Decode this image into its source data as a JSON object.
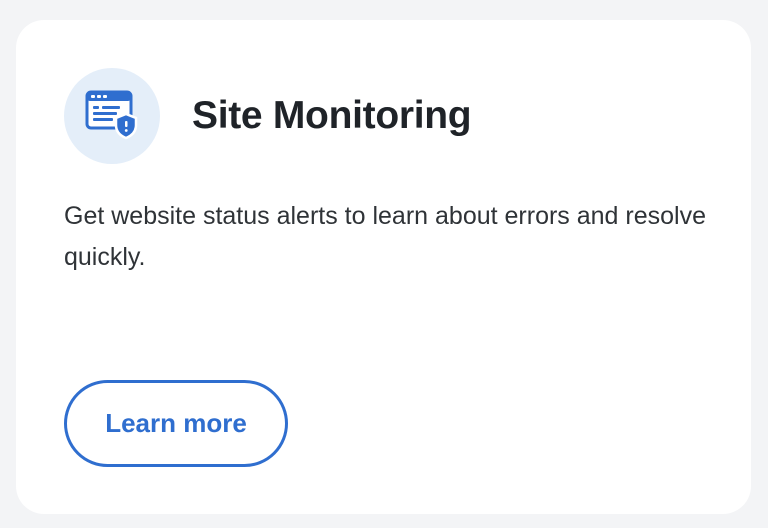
{
  "card": {
    "icon": "browser-shield-icon",
    "title": "Site Monitoring",
    "description": "Get website status alerts to learn about errors and resolve quickly.",
    "button_label": "Learn more"
  },
  "colors": {
    "accent": "#2f6ecf",
    "icon_background": "#e4eef9",
    "page_background": "#f3f4f6"
  }
}
